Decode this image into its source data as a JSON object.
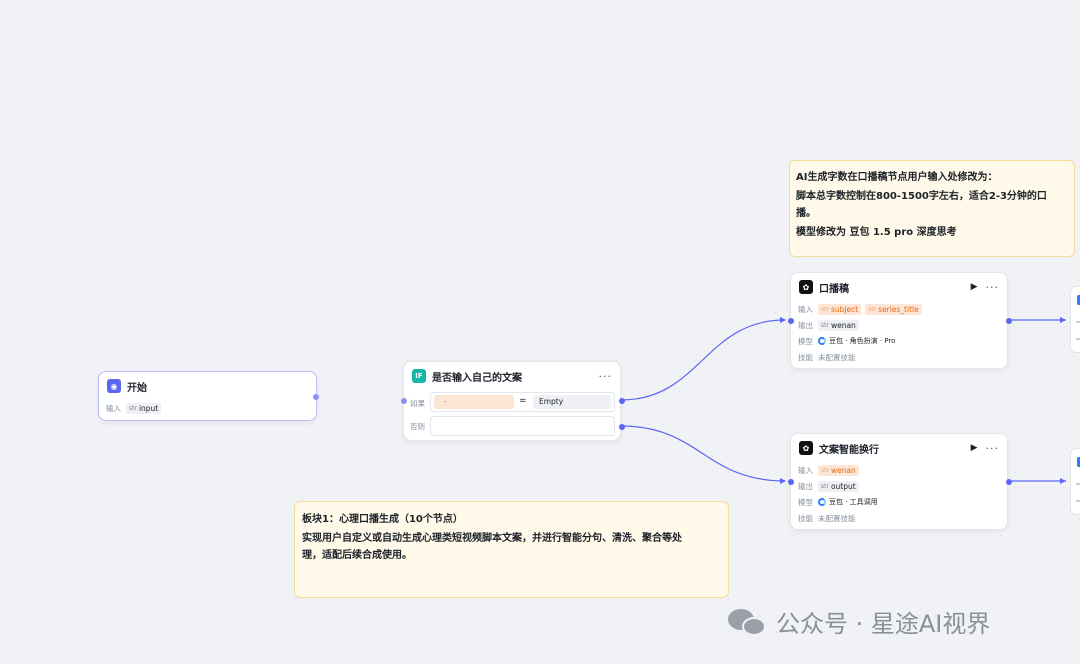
{
  "start_node": {
    "title": "开始",
    "input_label": "输入",
    "var_prefix": "str",
    "var_name": "input"
  },
  "if_node": {
    "icon": "IF",
    "title": "是否输入自己的文案",
    "menu": "···",
    "if_label": "如果",
    "cond_left": "-",
    "operator": "=",
    "cond_right": "Empty",
    "else_label": "否则"
  },
  "note_top": {
    "line1": "AI生成字数在口播稿节点用户输入处修改为：",
    "line2": "脚本总字数控制在800-1500字左右，适合2-3分钟的口",
    "line3": "播。",
    "line4": "模型修改为 豆包 1.5 pro 深度思考"
  },
  "koubo_node": {
    "title": "口播稿",
    "run_icon": "▶",
    "menu": "···",
    "input_label": "输入",
    "inputs": [
      "subject",
      "series_title"
    ],
    "output_label": "输出",
    "var_prefix": "str",
    "output": "wenan",
    "model_label": "模型",
    "model": "豆包 · 角色扮演 · Pro",
    "skill_label": "技能",
    "skill": "未配置技能"
  },
  "wrap_node": {
    "title": "文案智能换行",
    "run_icon": "▶",
    "menu": "···",
    "input_label": "输入",
    "input": "wenan",
    "output_label": "输出",
    "var_prefix": "str",
    "output": "output",
    "model_label": "模型",
    "model": "豆包 · 工具调用",
    "skill_label": "技能",
    "skill": "未配置技能"
  },
  "note_bottom": {
    "line1": "板块1：心理口播生成（10个节点）",
    "line2": "实现用户自定义或自动生成心理类短视频脚本文案，并进行智能分句、清洗、聚合等处",
    "line3": "理，适配后续合成使用。"
  },
  "watermark": {
    "text": "公众号 · 星途AI视界"
  },
  "colors": {
    "canvas": "#f1f2f5",
    "edge": "#5a67f2",
    "note_bg": "#fef9e8",
    "note_border": "#f4dc9c",
    "tag_orange": "#e06c19"
  }
}
